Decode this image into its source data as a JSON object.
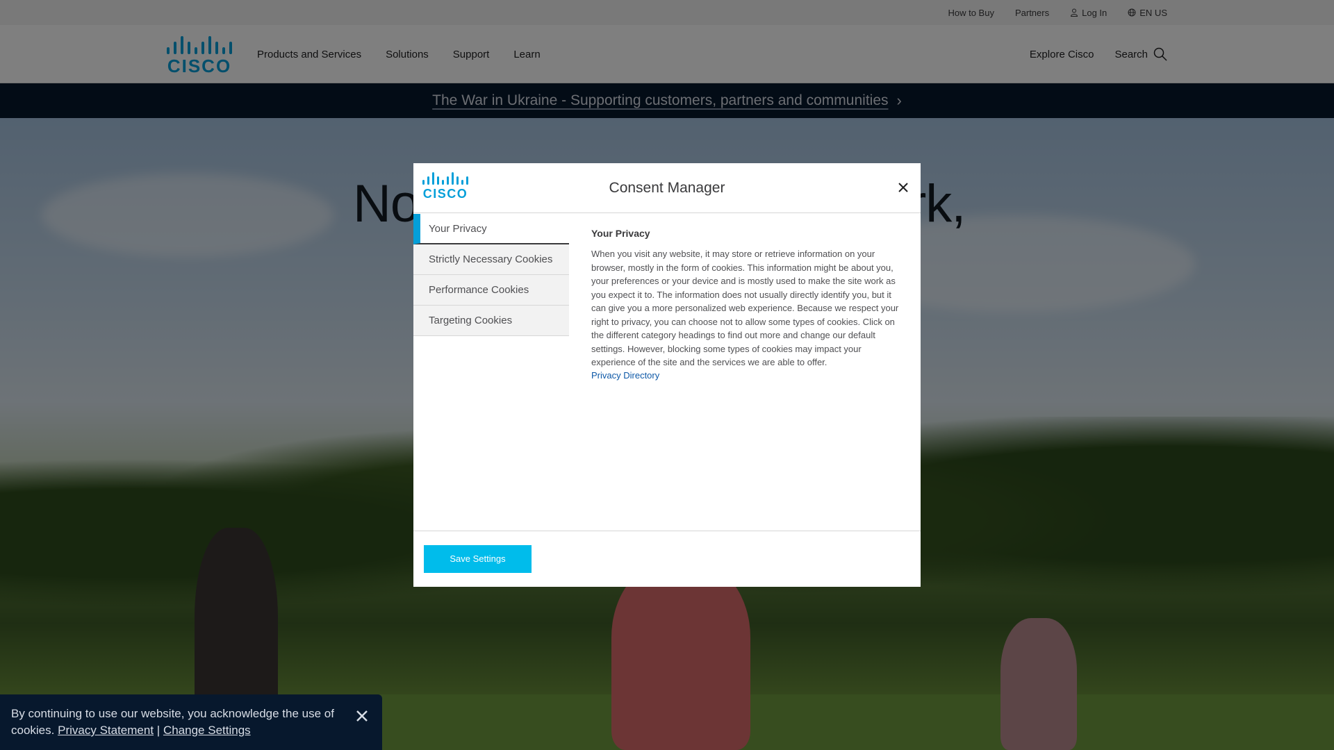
{
  "utility_bar": {
    "how_to_buy": "How to Buy",
    "partners": "Partners",
    "log_in": "Log In",
    "language": "EN US"
  },
  "nav": {
    "items": [
      "Products and Services",
      "Solutions",
      "Support",
      "Learn"
    ],
    "explore": "Explore Cisco",
    "search": "Search"
  },
  "banner": {
    "text": "The War in Ukraine - Supporting customers, partners and communities",
    "chevron": "›"
  },
  "hero": {
    "headline_start": "No",
    "headline_end": "rk,"
  },
  "modal": {
    "title": "Consent Manager",
    "tabs": [
      "Your Privacy",
      "Strictly Necessary Cookies",
      "Performance Cookies",
      "Targeting Cookies"
    ],
    "active_tab_index": 0,
    "content_title": "Your Privacy",
    "content_body": "When you visit any website, it may store or retrieve information on your browser, mostly in the form of cookies. This information might be about you, your preferences or your device and is mostly used to make the site work as you expect it to. The information does not usually directly identify you, but it can give you a more personalized web experience. Because we respect your right to privacy, you can choose not to allow some types of cookies. Click on the different category headings to find out more and change our default settings. However, blocking some types of cookies may impact your experience of the site and the services we are able to offer.",
    "content_link": "Privacy Directory",
    "save_button": "Save Settings"
  },
  "cookie_banner": {
    "text": "By continuing to use our website, you acknowledge the use of cookies.",
    "privacy_link": "Privacy Statement",
    "separator": "|",
    "settings_link": "Change Settings"
  },
  "colors": {
    "accent": "#049fd9",
    "button": "#00bceb",
    "banner_bg": "#07182d",
    "link": "#0d58a7"
  },
  "icons": [
    "cisco-logo",
    "person-icon",
    "globe-icon",
    "search-icon",
    "chevron-right-icon",
    "close-icon"
  ]
}
